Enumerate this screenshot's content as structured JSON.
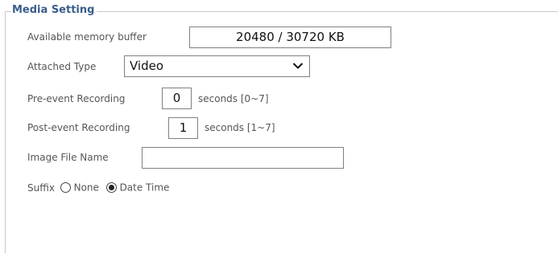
{
  "section": {
    "title": "Media Setting"
  },
  "memory": {
    "label": "Available memory buffer",
    "value": "20480 / 30720 KB"
  },
  "attached": {
    "label": "Attached Type",
    "selected": "Video"
  },
  "pre_event": {
    "label": "Pre-event Recording",
    "value": "0",
    "range": "seconds [0~7]"
  },
  "post_event": {
    "label": "Post-event Recording",
    "value": "1",
    "range": "seconds [1~7]"
  },
  "image_file": {
    "label": "Image File Name",
    "value": ""
  },
  "suffix": {
    "label": "Suffix",
    "options": [
      {
        "label": "None",
        "checked": false
      },
      {
        "label": "Date Time",
        "checked": true
      }
    ]
  }
}
